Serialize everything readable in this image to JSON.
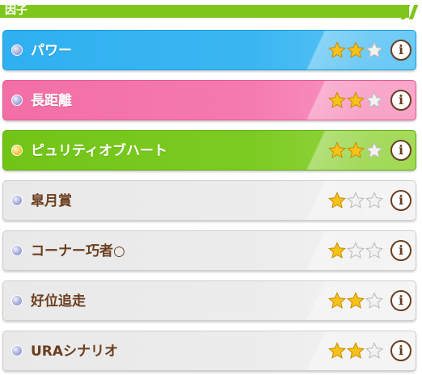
{
  "section": {
    "title": "因子"
  },
  "factors": [
    {
      "name": "パワー",
      "color": "blue",
      "dot": "lav",
      "stars_filled": 2,
      "stars_total": 3,
      "info_label": "i"
    },
    {
      "name": "長距離",
      "color": "pink",
      "dot": "lav",
      "stars_filled": 2,
      "stars_total": 3,
      "info_label": "i"
    },
    {
      "name": "ピュリティオブハート",
      "color": "green",
      "dot": "gold",
      "stars_filled": 2,
      "stars_total": 3,
      "info_label": "i"
    },
    {
      "name": "皐月賞",
      "color": "gray",
      "dot": "lav",
      "stars_filled": 1,
      "stars_total": 3,
      "info_label": "i"
    },
    {
      "name": "コーナー巧者○",
      "color": "gray",
      "dot": "lav",
      "stars_filled": 1,
      "stars_total": 3,
      "info_label": "i"
    },
    {
      "name": "好位追走",
      "color": "gray",
      "dot": "lav",
      "stars_filled": 2,
      "stars_total": 3,
      "info_label": "i"
    },
    {
      "name": "URAシナリオ",
      "color": "gray",
      "dot": "lav",
      "stars_filled": 2,
      "stars_total": 3,
      "info_label": "i"
    }
  ],
  "colors": {
    "header_green": "#7ec61b",
    "blue": "#2fb0f0",
    "pink": "#f26fa5",
    "green": "#72c417",
    "gray": "#e9e9e9",
    "text_brown": "#6b3e1f",
    "star_gold": "#f5c21a"
  },
  "icons": {
    "star_filled": "star-filled-icon",
    "star_empty": "star-empty-icon",
    "info": "info-icon",
    "dot": "factor-dot-icon"
  }
}
